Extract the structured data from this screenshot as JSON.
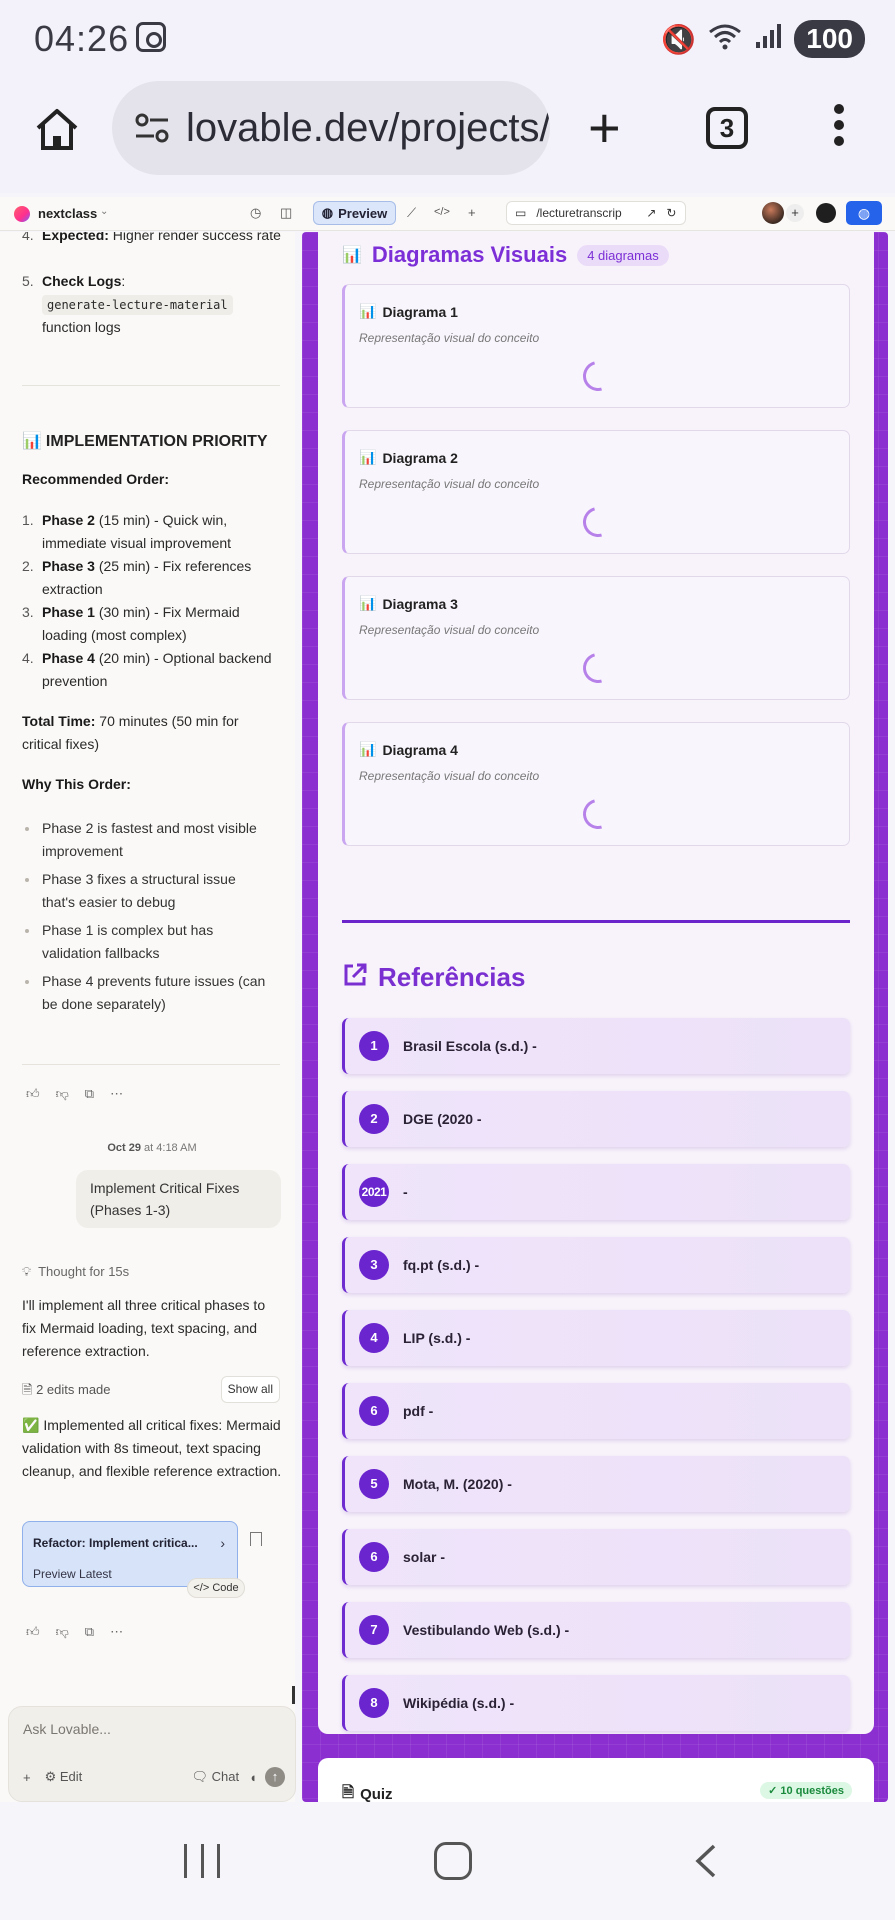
{
  "status_bar": {
    "time": "04:26",
    "battery": "100",
    "icons": [
      "screen-record-icon",
      "mute-icon",
      "wifi-6-icon",
      "signal-icon"
    ]
  },
  "browser": {
    "url": "lovable.dev/projects/",
    "tab_count": "3",
    "icons": [
      "home-icon",
      "site-settings-icon",
      "plus-icon",
      "more-vert-icon"
    ]
  },
  "toolbar": {
    "project_name": "nextclass",
    "preview_label": "Preview",
    "add_label": "+",
    "preview_path": "/lecturetranscrip",
    "avatar_plus": "+"
  },
  "chat": {
    "top_items": [
      {
        "num": "4.",
        "label": "Expected:",
        "text": " Higher render success rate"
      },
      {
        "num": "5.",
        "label": "Check Logs",
        "text": ":",
        "code": "generate-lecture-material",
        "after": "function logs"
      }
    ],
    "section_title": "IMPLEMENTATION PRIORITY",
    "section_emoji": "📊",
    "recommended_label": "Recommended Order:",
    "priority_items": [
      {
        "num": "1.",
        "phase": "Phase 2",
        "desc": " (15 min) - Quick win, immediate visual improvement"
      },
      {
        "num": "2.",
        "phase": "Phase 3",
        "desc": " (25 min) - Fix references extraction"
      },
      {
        "num": "3.",
        "phase": "Phase 1",
        "desc": " (30 min) - Fix Mermaid loading (most complex)"
      },
      {
        "num": "4.",
        "phase": "Phase 4",
        "desc": " (20 min) - Optional backend prevention"
      }
    ],
    "total_time_label": "Total Time:",
    "total_time_value": " 70 minutes (50 min for critical fixes)",
    "why_label": "Why This Order:",
    "why_items": [
      "Phase 2 is fastest and most visible improvement",
      "Phase 3 fixes a structural issue that's easier to debug",
      "Phase 1 is complex but has validation fallbacks",
      "Phase 4 prevents future issues (can be done separately)"
    ],
    "timestamp_date": "Oct 29",
    "timestamp_time": " at 4:18 AM",
    "user_message": "Implement Critical Fixes (Phases 1-3)",
    "thought": "Thought for 15s",
    "reply": "I'll implement all three critical phases to fix Mermaid loading, text spacing, and reference extraction.",
    "edits_made": "2 edits made",
    "show_all": "Show all",
    "summary_emoji": "✅",
    "summary": " Implemented all critical fixes: Mermaid validation with 8s timeout, text spacing cleanup, and flexible reference extraction.",
    "commit_title": "Refactor: Implement critica...",
    "commit_sub": "Preview Latest",
    "code_label": "Code",
    "ask_placeholder": "Ask Lovable...",
    "edit_label": "Edit",
    "chat_label": "Chat"
  },
  "preview": {
    "diagrams_title": "Diagramas Visuais",
    "diagrams_count": "4 diagramas",
    "diagrams": [
      {
        "title": "Diagrama 1",
        "subtitle": "Representação visual do conceito"
      },
      {
        "title": "Diagrama 2",
        "subtitle": "Representação visual do conceito"
      },
      {
        "title": "Diagrama 3",
        "subtitle": "Representação visual do conceito"
      },
      {
        "title": "Diagrama 4",
        "subtitle": "Representação visual do conceito"
      }
    ],
    "references_title": "Referências",
    "references": [
      {
        "num": "1",
        "text": "Brasil Escola (s.d.) -"
      },
      {
        "num": "2",
        "text": "DGE (2020 -"
      },
      {
        "num": "2021",
        "text": "-"
      },
      {
        "num": "3",
        "text": "fq.pt (s.d.) -"
      },
      {
        "num": "4",
        "text": "LIP (s.d.) -"
      },
      {
        "num": "6",
        "text": "pdf -"
      },
      {
        "num": "5",
        "text": "Mota, M. (2020) -"
      },
      {
        "num": "6",
        "text": "solar -"
      },
      {
        "num": "7",
        "text": "Vestibulando Web (s.d.) -"
      },
      {
        "num": "8",
        "text": "Wikipédia (s.d.) -"
      }
    ],
    "quiz_title": "Quiz",
    "quiz_badge": "✓ 10 questões"
  },
  "colors": {
    "preview_bg": "#8c2fd0",
    "accent_purple": "#7c2fd6",
    "ref_badge": "#6a25cf",
    "primary_blue": "#2563eb"
  }
}
